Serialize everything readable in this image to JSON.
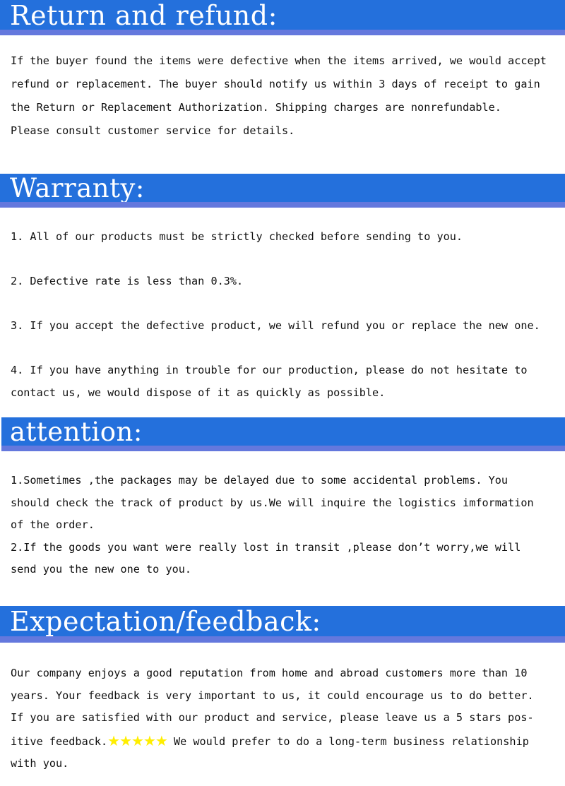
{
  "document": {
    "title": "Return and refund / Warranty / attention / Expectation-feedback policy page",
    "accent_color": "#2470dc",
    "accent_strip_color": "#6478dd",
    "star_color": "#ffee00",
    "text_color": "#111111",
    "header_text_color": "#ffffff",
    "background_color": "#ffffff"
  },
  "sections": [
    {
      "id": "return-and-refund",
      "heading": "Return and refund:",
      "lines": [
        "If the buyer found the items were defective when the items arrived, we would accept",
        "refund or replacement. The buyer should notify us within 3 days of receipt to gain",
        "the Return or Replacement Authorization. Shipping charges are nonrefundable.",
        "Please consult customer service for details."
      ]
    },
    {
      "id": "warranty",
      "heading": "Warranty:",
      "lines": [
        "1. All of our products must be strictly checked before sending to you.",
        "2. Defective rate is less than 0.3%.",
        "3. If you accept the defective product, we will refund you or replace the new one.",
        "4. If you have anything in trouble for our production, please do not hesitate to",
        "contact us, we would dispose of it as quickly as possible."
      ]
    },
    {
      "id": "attention",
      "heading": "attention:",
      "lines": [
        "1.Sometimes ,the packages may be delayed due to some accidental problems. You",
        "should check the track of product by us.We will inquire the logistics imformation",
        "of the order.",
        "2.If the goods you want were really lost in transit ,please don’t worry,we will",
        "send you the new one to you."
      ]
    },
    {
      "id": "expectation-feedback",
      "heading": "Expectation/feedback:",
      "lines": [
        "Our company enjoys a good reputation from home and abroad customers more than 10",
        "years. Your feedback is very important to us, it could encourage us to do better.",
        "If you are satisfied with our product and service, please leave us a 5 stars pos-",
        "itive feedback.",
        " We would prefer to do a long-term business relationship",
        "with you."
      ],
      "star_rating": {
        "count": 5,
        "glyphs": "★★★★★",
        "color": "#ffee00"
      }
    }
  ]
}
